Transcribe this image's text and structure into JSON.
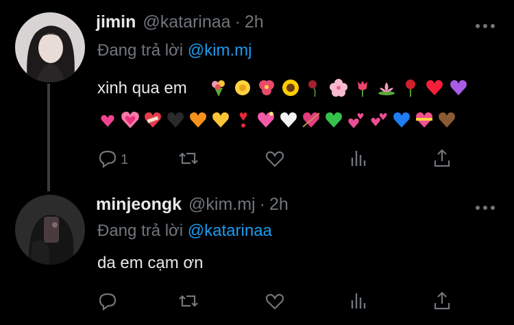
{
  "tweets": [
    {
      "name": "jimin",
      "handle": "@katarinaa",
      "dot": "·",
      "time": "2h",
      "reply_prefix": "Đang trả lời ",
      "reply_to": "@kim.mj",
      "text": "xinh qua em",
      "emoji_row1": [
        "bouquet",
        "sunflower-small",
        "hibiscus",
        "sunflower",
        "wilted-rose",
        "cherry-blossom",
        "tulip",
        "lotus",
        "rose",
        "red-heart",
        "purple-heart"
      ],
      "emoji_row2": [
        "beating-heart",
        "growing-heart",
        "mending-heart",
        "black-heart",
        "orange-heart",
        "yellow-heart",
        "exclamation-heart",
        "sparkling-heart",
        "white-heart",
        "arrow-heart",
        "green-heart",
        "two-hearts",
        "revolving-hearts",
        "blue-heart",
        "heart-ribbon",
        "brown-heart"
      ],
      "reply_count": "1"
    },
    {
      "name": "minjeongk",
      "handle": "@kim.mj",
      "dot": "·",
      "time": "2h",
      "reply_prefix": "Đang trả lời ",
      "reply_to": "@katarinaa",
      "text": "da em cạm ơn",
      "reply_count": ""
    }
  ],
  "colors": {
    "background": "#000000",
    "text": "#e7e9ea",
    "muted": "#71767b",
    "link": "#1d9bf0"
  },
  "icons": [
    "reply-icon",
    "retweet-icon",
    "like-icon",
    "views-icon",
    "share-icon",
    "more-icon"
  ]
}
